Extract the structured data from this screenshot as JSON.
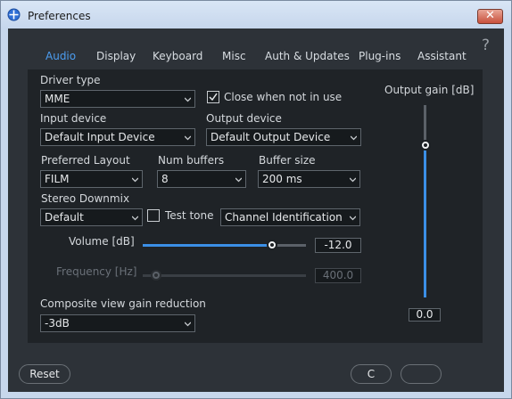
{
  "window": {
    "title": "Preferences",
    "close_symbol": "✕"
  },
  "help_symbol": "?",
  "tabs": [
    {
      "label": "Audio",
      "active": true
    },
    {
      "label": "Display",
      "active": false
    },
    {
      "label": "Keyboard",
      "active": false
    },
    {
      "label": "Misc",
      "active": false
    },
    {
      "label": "Auth & Updates",
      "active": false
    },
    {
      "label": "Plug-ins",
      "active": false
    },
    {
      "label": "Assistant",
      "active": false
    }
  ],
  "audio": {
    "driver_type": {
      "label": "Driver type",
      "value": "MME"
    },
    "close_when_not_in_use": {
      "label": "Close when not in use",
      "checked": true
    },
    "input_device": {
      "label": "Input device",
      "value": "Default Input Device"
    },
    "output_device": {
      "label": "Output device",
      "value": "Default Output Device"
    },
    "preferred_layout": {
      "label": "Preferred Layout",
      "value": "FILM"
    },
    "num_buffers": {
      "label": "Num buffers",
      "value": "8"
    },
    "buffer_size": {
      "label": "Buffer size",
      "value": "200 ms"
    },
    "stereo_downmix": {
      "label": "Stereo Downmix",
      "value": "Default"
    },
    "test_tone": {
      "label": "Test tone",
      "checked": false
    },
    "test_tone_signal": {
      "value": "Channel Identification"
    },
    "volume": {
      "label": "Volume [dB]",
      "value": "-12.0",
      "level": 0.79
    },
    "frequency": {
      "label": "Frequency [Hz]",
      "value": "400.0",
      "level": 0.08,
      "enabled": false
    },
    "composite_gain": {
      "label": "Composite view gain reduction",
      "value": "-3dB"
    },
    "output_gain": {
      "label": "Output gain [dB]",
      "value": "0.0",
      "level": 0.79
    }
  },
  "footer": {
    "reset_label": "Reset",
    "ok_label": "C"
  },
  "colors": {
    "accent": "#3b8fe6",
    "panel": "#1f2327",
    "background": "#2d3238"
  }
}
